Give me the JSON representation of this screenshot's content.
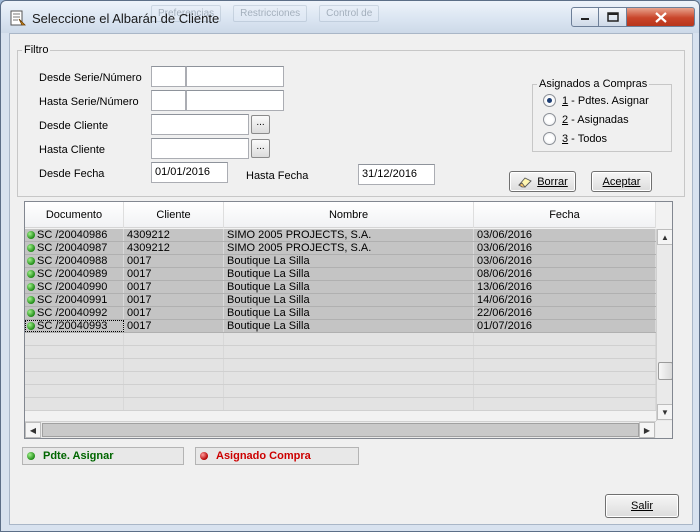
{
  "window": {
    "title": "Seleccione el Albarán de Cliente"
  },
  "background_toolbar": [
    "Preferencias",
    "Restricciones",
    "Control de"
  ],
  "filter": {
    "legend": "Filtro",
    "desde_serie_label": "Desde Serie/Número",
    "hasta_serie_label": "Hasta Serie/Número",
    "desde_cliente_label": "Desde Cliente",
    "hasta_cliente_label": "Hasta Cliente",
    "desde_fecha_label": "Desde Fecha",
    "hasta_fecha_label": "Hasta Fecha",
    "desde_serie_value": "",
    "desde_numero_value": "",
    "hasta_serie_value": "",
    "hasta_numero_value": "",
    "desde_cliente_value": "",
    "hasta_cliente_value": "",
    "desde_fecha_value": "01/01/2016",
    "hasta_fecha_value": "31/12/2016",
    "lookup_label": "...",
    "asignados": {
      "legend": "Asignados a Compras",
      "options": [
        {
          "key": "1",
          "label": " - Pdtes. Asignar",
          "selected": true
        },
        {
          "key": "2",
          "label": " - Asignadas",
          "selected": false
        },
        {
          "key": "3",
          "label": " - Todos",
          "selected": false
        }
      ]
    },
    "borrar_label": "Borrar",
    "aceptar_label": "Aceptar"
  },
  "grid": {
    "columns": [
      "Documento",
      "Cliente",
      "Nombre",
      "Fecha"
    ],
    "rows": [
      {
        "documento": "SC /20040986",
        "cliente": "4309212",
        "nombre": "SIMO 2005 PROJECTS, S.A.",
        "fecha": "03/06/2016"
      },
      {
        "documento": "SC /20040987",
        "cliente": "4309212",
        "nombre": "SIMO 2005 PROJECTS, S.A.",
        "fecha": "03/06/2016"
      },
      {
        "documento": "SC /20040988",
        "cliente": "0017",
        "nombre": "Boutique La Silla",
        "fecha": "03/06/2016"
      },
      {
        "documento": "SC /20040989",
        "cliente": "0017",
        "nombre": "Boutique La Silla",
        "fecha": "08/06/2016"
      },
      {
        "documento": "SC /20040990",
        "cliente": "0017",
        "nombre": "Boutique La Silla",
        "fecha": "13/06/2016"
      },
      {
        "documento": "SC /20040991",
        "cliente": "0017",
        "nombre": "Boutique La Silla",
        "fecha": "14/06/2016"
      },
      {
        "documento": "SC /20040992",
        "cliente": "0017",
        "nombre": "Boutique La Silla",
        "fecha": "22/06/2016"
      },
      {
        "documento": "SC /20040993",
        "cliente": "0017",
        "nombre": "Boutique La Silla",
        "fecha": "01/07/2016"
      }
    ]
  },
  "legend": {
    "pdte_label": "Pdte. Asignar",
    "pdte_color": "#006600",
    "asignado_label": "Asignado Compra",
    "asignado_color": "#cc0000"
  },
  "salir_label": "Salir"
}
